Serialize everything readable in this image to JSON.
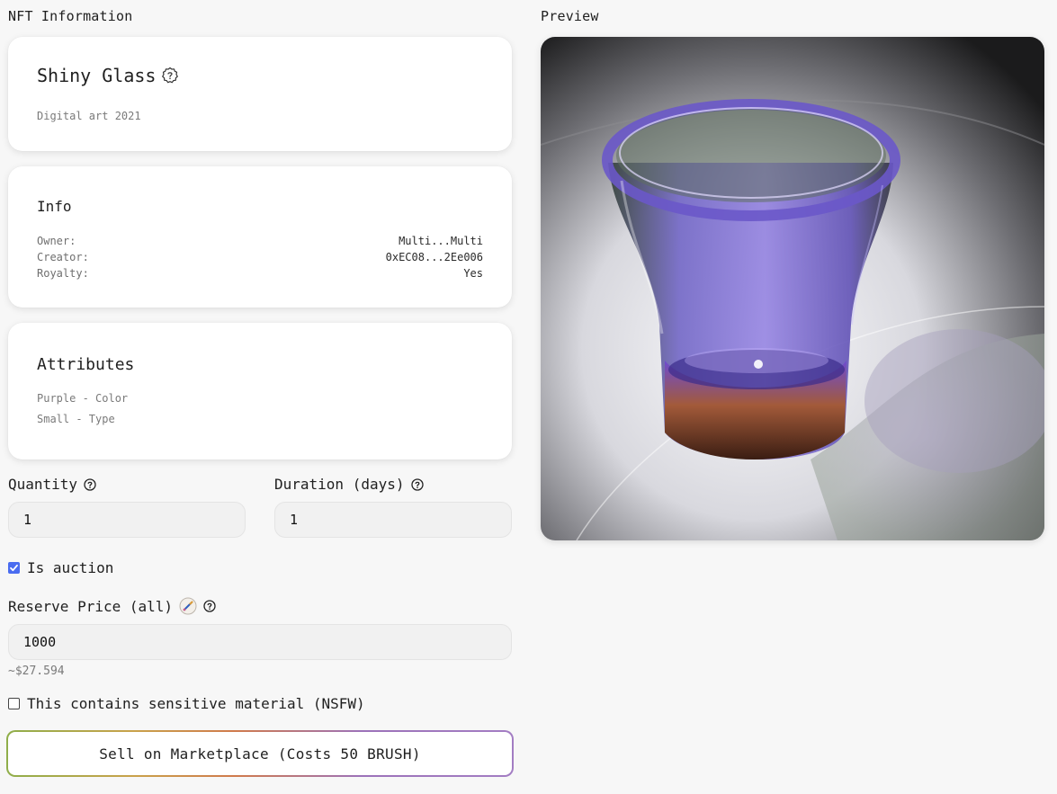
{
  "nft_info": {
    "section_title": "NFT Information",
    "name": "Shiny Glass",
    "subtitle": "Digital art 2021"
  },
  "info": {
    "heading": "Info",
    "rows": [
      {
        "key": "Owner:",
        "value": "Multi...Multi"
      },
      {
        "key": "Creator:",
        "value": "0xEC08...2Ee006"
      },
      {
        "key": "Royalty:",
        "value": "Yes"
      }
    ]
  },
  "attributes": {
    "heading": "Attributes",
    "items": [
      "Purple - Color",
      "Small - Type"
    ]
  },
  "form": {
    "quantity_label": "Quantity",
    "quantity_value": "1",
    "duration_label": "Duration (days)",
    "duration_value": "1",
    "auction_label": "Is auction",
    "auction_checked": true,
    "reserve_label": "Reserve Price (all)",
    "reserve_value": "1000",
    "usd_estimate": "~$27.594",
    "nsfw_label": "This contains sensitive material (NSFW)",
    "nsfw_checked": false,
    "sell_button": "Sell on Marketplace (Costs 50 BRUSH)"
  },
  "preview": {
    "section_title": "Preview"
  },
  "colors": {
    "checkbox_accent": "#4a6cf0",
    "glass_purple": "#7b5bd6",
    "glass_amber": "#b5642a"
  },
  "icons": [
    "help-badge-icon",
    "question-circle-icon",
    "brush-token-icon",
    "checkmark-icon"
  ]
}
